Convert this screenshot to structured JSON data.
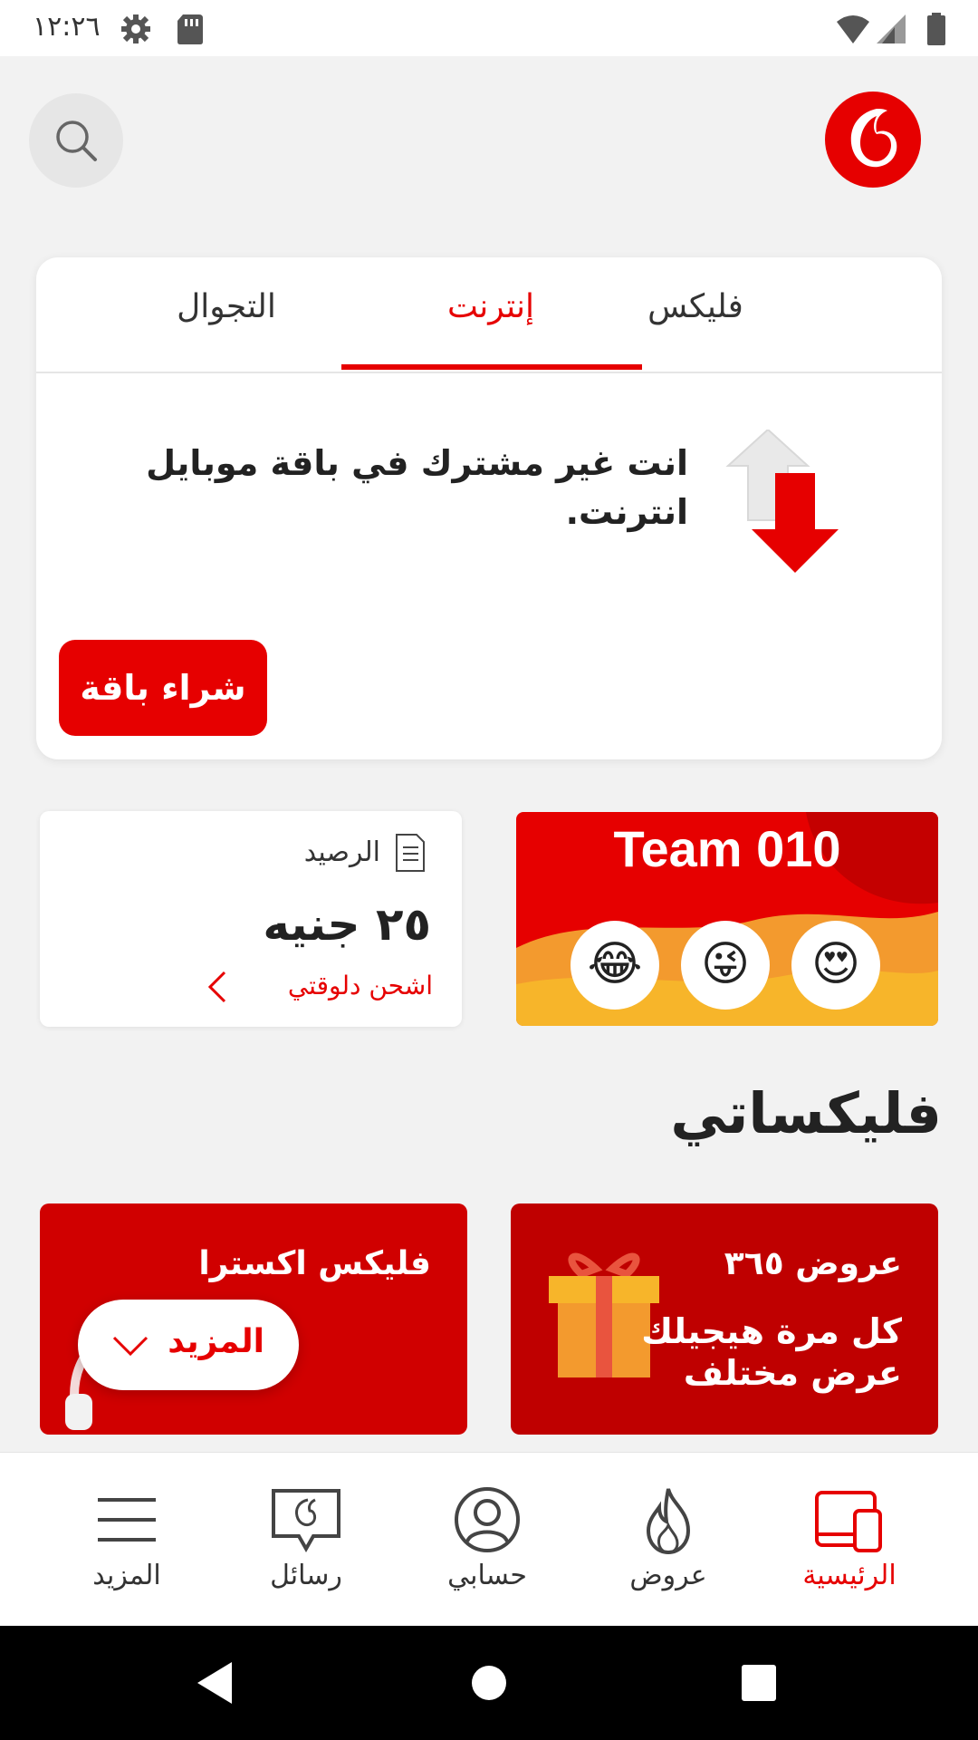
{
  "status_bar": {
    "time": "١٢:٢٦",
    "icons": [
      "sim-card-icon",
      "settings-icon",
      "wifi-icon",
      "signal-icon",
      "battery-icon"
    ]
  },
  "header": {
    "search_icon": "search-icon",
    "logo": "vodafone-logo"
  },
  "main_card": {
    "tabs": [
      {
        "label": "فليكس",
        "active": false
      },
      {
        "label": "إنترنت",
        "active": true
      },
      {
        "label": "التجوال",
        "active": false
      }
    ],
    "notice": "انت غير مشترك في باقة موبايل انترنت.",
    "buy_button": "شراء باقة"
  },
  "balance": {
    "label": "الرصيد",
    "amount": "٢٥ جنيه",
    "recharge": "اشحن دلوقتي"
  },
  "team_banner": {
    "title": "Team 010",
    "emojis": [
      "😍",
      "😜",
      "😂"
    ]
  },
  "section": {
    "title": "فليكساتي"
  },
  "offers": [
    {
      "title": "عروض ٣٦٥",
      "subtitle": "كل مرة هيجيلك عرض مختلف"
    },
    {
      "title": "فليكس اكسترا",
      "subtitle": ""
    }
  ],
  "more_pill": {
    "label": "المزيد"
  },
  "bottom_nav": [
    {
      "label": "الرئيسية",
      "icon": "home-devices-icon",
      "active": true
    },
    {
      "label": "عروض",
      "icon": "flame-icon",
      "active": false
    },
    {
      "label": "حسابي",
      "icon": "account-icon",
      "active": false
    },
    {
      "label": "رسائل",
      "icon": "messages-icon",
      "active": false
    },
    {
      "label": "المزيد",
      "icon": "menu-icon",
      "active": false
    }
  ],
  "colors": {
    "brand_red": "#e60000",
    "background": "#f2f2f2"
  }
}
